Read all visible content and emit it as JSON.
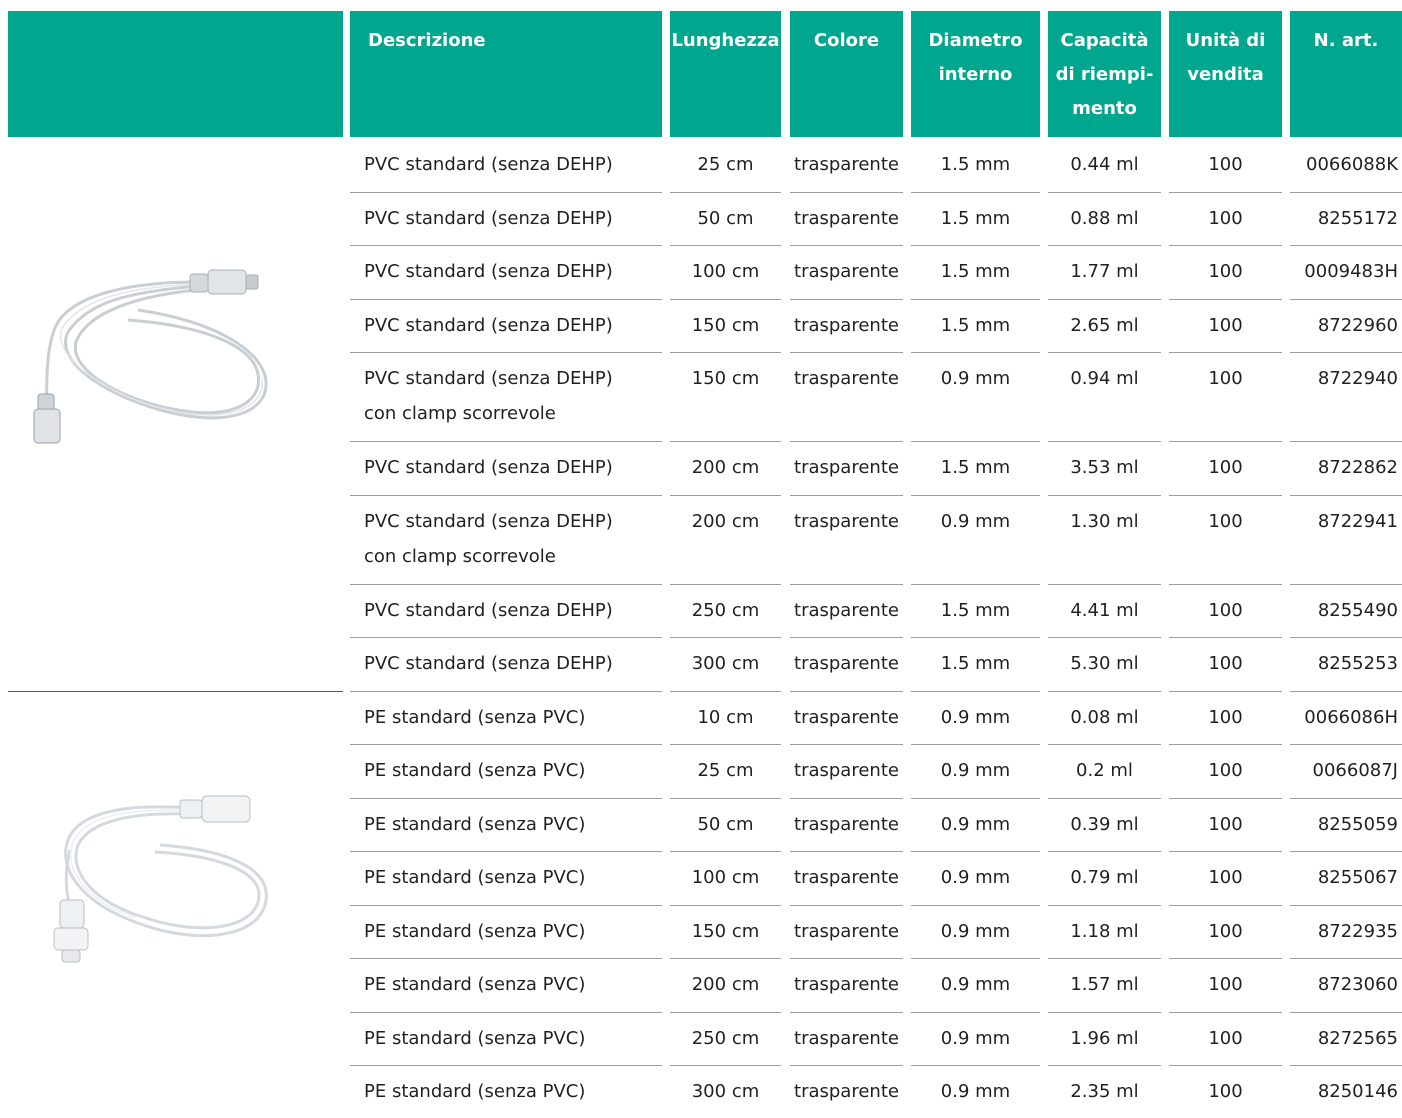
{
  "colors": {
    "header_bg": "#00a68d",
    "header_text": "#ffffff",
    "rule": "#9d9d9d"
  },
  "header": {
    "descrizione": "Descrizione",
    "lunghezza": "Lunghezza",
    "colore": "Colore",
    "diametro": "Diametro\ninterno",
    "capacita": "Capacità\ndi riempi-\nmento",
    "unita": "Unità di\nvendita",
    "articolo": "N. art."
  },
  "images": [
    {
      "name": "pvc-extension-line-image",
      "icon": "tubing-pvc"
    },
    {
      "name": "pe-extension-line-image",
      "icon": "tubing-pe"
    }
  ],
  "rows": [
    {
      "descrizione": "PVC standard (senza DEHP)",
      "lunghezza": "25 cm",
      "colore": "trasparente",
      "diametro": "1.5 mm",
      "capacita": "0.44 ml",
      "unita": "100",
      "articolo": "0066088K"
    },
    {
      "descrizione": "PVC standard (senza DEHP)",
      "lunghezza": "50 cm",
      "colore": "trasparente",
      "diametro": "1.5 mm",
      "capacita": "0.88 ml",
      "unita": "100",
      "articolo": "8255172"
    },
    {
      "descrizione": "PVC standard (senza DEHP)",
      "lunghezza": "100 cm",
      "colore": "trasparente",
      "diametro": "1.5 mm",
      "capacita": "1.77 ml",
      "unita": "100",
      "articolo": "0009483H"
    },
    {
      "descrizione": "PVC standard (senza DEHP)",
      "lunghezza": "150 cm",
      "colore": "trasparente",
      "diametro": "1.5 mm",
      "capacita": "2.65 ml",
      "unita": "100",
      "articolo": "8722960"
    },
    {
      "descrizione": "PVC standard (senza DEHP)",
      "descrizione2": "con clamp scorrevole",
      "lunghezza": "150 cm",
      "colore": "trasparente",
      "diametro": "0.9 mm",
      "capacita": "0.94 ml",
      "unita": "100",
      "articolo": "8722940"
    },
    {
      "descrizione": "PVC standard (senza DEHP)",
      "lunghezza": "200 cm",
      "colore": "trasparente",
      "diametro": "1.5 mm",
      "capacita": "3.53 ml",
      "unita": "100",
      "articolo": "8722862"
    },
    {
      "descrizione": "PVC standard (senza DEHP)",
      "descrizione2": "con clamp scorrevole",
      "lunghezza": "200 cm",
      "colore": "trasparente",
      "diametro": "0.9 mm",
      "capacita": "1.30 ml",
      "unita": "100",
      "articolo": "8722941"
    },
    {
      "descrizione": "PVC standard (senza DEHP)",
      "lunghezza": "250 cm",
      "colore": "trasparente",
      "diametro": "1.5 mm",
      "capacita": "4.41 ml",
      "unita": "100",
      "articolo": "8255490"
    },
    {
      "descrizione": "PVC standard (senza DEHP)",
      "lunghezza": "300 cm",
      "colore": "trasparente",
      "diametro": "1.5 mm",
      "capacita": "5.30 ml",
      "unita": "100",
      "articolo": "8255253"
    },
    {
      "descrizione": "PE standard (senza PVC)",
      "lunghezza": "10 cm",
      "colore": "trasparente",
      "diametro": "0.9 mm",
      "capacita": "0.08 ml",
      "unita": "100",
      "articolo": "0066086H"
    },
    {
      "descrizione": "PE standard (senza PVC)",
      "lunghezza": "25 cm",
      "colore": "trasparente",
      "diametro": "0.9 mm",
      "capacita": "0.2 ml",
      "unita": "100",
      "articolo": "0066087J"
    },
    {
      "descrizione": "PE standard (senza PVC)",
      "lunghezza": "50 cm",
      "colore": "trasparente",
      "diametro": "0.9 mm",
      "capacita": "0.39 ml",
      "unita": "100",
      "articolo": "8255059"
    },
    {
      "descrizione": "PE standard (senza PVC)",
      "lunghezza": "100 cm",
      "colore": "trasparente",
      "diametro": "0.9 mm",
      "capacita": "0.79 ml",
      "unita": "100",
      "articolo": "8255067"
    },
    {
      "descrizione": "PE standard (senza PVC)",
      "lunghezza": "150 cm",
      "colore": "trasparente",
      "diametro": "0.9 mm",
      "capacita": "1.18 ml",
      "unita": "100",
      "articolo": "8722935"
    },
    {
      "descrizione": "PE standard (senza PVC)",
      "lunghezza": "200 cm",
      "colore": "trasparente",
      "diametro": "0.9 mm",
      "capacita": "1.57 ml",
      "unita": "100",
      "articolo": "8723060"
    },
    {
      "descrizione": "PE standard (senza PVC)",
      "lunghezza": "250 cm",
      "colore": "trasparente",
      "diametro": "0.9 mm",
      "capacita": "1.96 ml",
      "unita": "100",
      "articolo": "8272565"
    },
    {
      "descrizione": "PE standard (senza PVC)",
      "lunghezza": "300 cm",
      "colore": "trasparente",
      "diametro": "0.9 mm",
      "capacita": "2.35 ml",
      "unita": "100",
      "articolo": "8250146"
    }
  ]
}
